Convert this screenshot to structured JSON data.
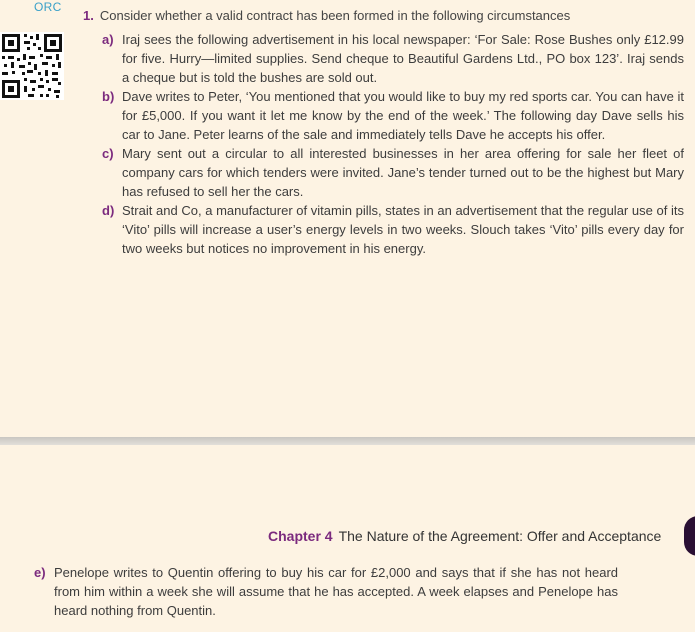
{
  "orc_label": "ORC",
  "question": {
    "number": "1.",
    "heading": "Consider whether a valid contract has been formed in the following circumstances"
  },
  "items": [
    {
      "label": "a)",
      "text": "Iraj sees the following advertisement in his local newspaper: ‘For Sale: Rose Bushes only £12.99 for five. Hurry—limited supplies. Send cheque to Beautiful Gardens Ltd., PO box 123’. Iraj sends a cheque but is told the bushes are sold out."
    },
    {
      "label": "b)",
      "text": "Dave writes to Peter, ‘You mentioned that you would like to buy my red sports car. You can have it for £5,000. If you want it let me know by the end of the week.’ The following day Dave sells his car to Jane. Peter learns of the sale and immediately tells Dave he accepts his offer."
    },
    {
      "label": "c)",
      "text": "Mary sent out a circular to all interested businesses in her area offering for sale her fleet of company cars for which tenders were invited. Jane’s tender turned out to be the highest but Mary has refused to sell her the cars."
    },
    {
      "label": "d)",
      "text": "Strait and Co, a manufacturer of vitamin pills, states in an advertisement that the regular use of its ‘Vito’ pills will increase a user’s energy levels in two weeks. Slouch takes ‘Vito’ pills every day for two weeks but notices no improvement in his energy."
    }
  ],
  "chapter": {
    "number": "Chapter 4",
    "title": "The Nature of the Agreement: Offer and Acceptance"
  },
  "item_e": {
    "label": "e)",
    "text": "Penelope writes to Quentin offering to buy his car for £2,000 and says that if she has not heard from him within a week she will assume that he has accepted. A week elapses and Penelope has heard nothing from Quentin."
  },
  "colors": {
    "accent": "#7b2a7e",
    "orc": "#3aa0c8",
    "page": "#fdf3e3"
  }
}
